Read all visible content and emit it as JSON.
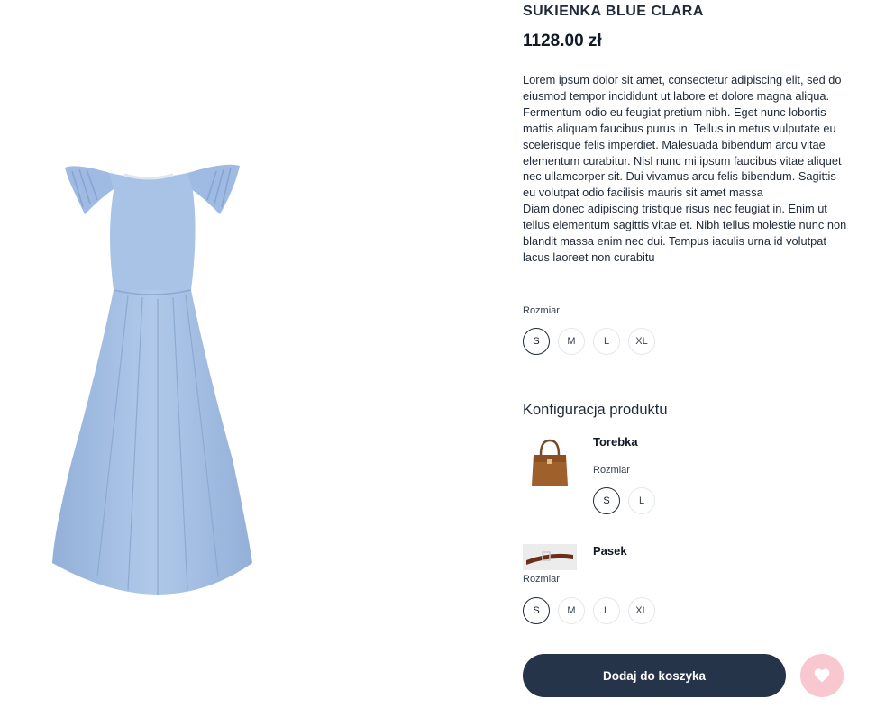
{
  "product": {
    "title": "SUKIENKA BLUE CLARA",
    "price": "1128.00 zł",
    "description": [
      "Lorem ipsum dolor sit amet, consectetur adipiscing elit, sed do eiusmod tempor incididunt ut labore et dolore magna aliqua. Fermentum odio eu feugiat pretium nibh. Eget nunc lobortis mattis aliquam faucibus purus in. Tellus in metus vulputate eu scelerisque felis imperdiet. Malesuada bibendum arcu vitae elementum curabitur. Nisl nunc mi ipsum faucibus vitae aliquet nec ullamcorper sit. Dui vivamus arcu felis bibendum. Sagittis eu volutpat odio facilisis mauris sit amet massa",
      "Diam donec adipiscing tristique risus nec feugiat in. Enim ut tellus elementum sagittis vitae et. Nibh tellus molestie nunc non blandit massa enim nec dui. Tempus iaculis urna id volutpat lacus laoreet non curabitu"
    ],
    "size_label": "Rozmiar",
    "sizes": [
      "S",
      "M",
      "L",
      "XL"
    ],
    "selected_size": "S"
  },
  "configuration": {
    "title": "Konfiguracja produktu",
    "options": [
      {
        "name": "Torebka",
        "size_label": "Rozmiar",
        "sizes": [
          "S",
          "L"
        ],
        "selected_size": "S"
      },
      {
        "name": "Pasek",
        "size_label": "Rozmiar",
        "sizes": [
          "S",
          "M",
          "L",
          "XL"
        ],
        "selected_size": "S"
      }
    ]
  },
  "actions": {
    "add_to_cart_label": "Dodaj do koszyka",
    "favorite_icon": "heart-icon"
  },
  "colors": {
    "dress": "#a9c3e6",
    "cart_button": "#26344a",
    "favorite_button": "#f8c7cf"
  }
}
